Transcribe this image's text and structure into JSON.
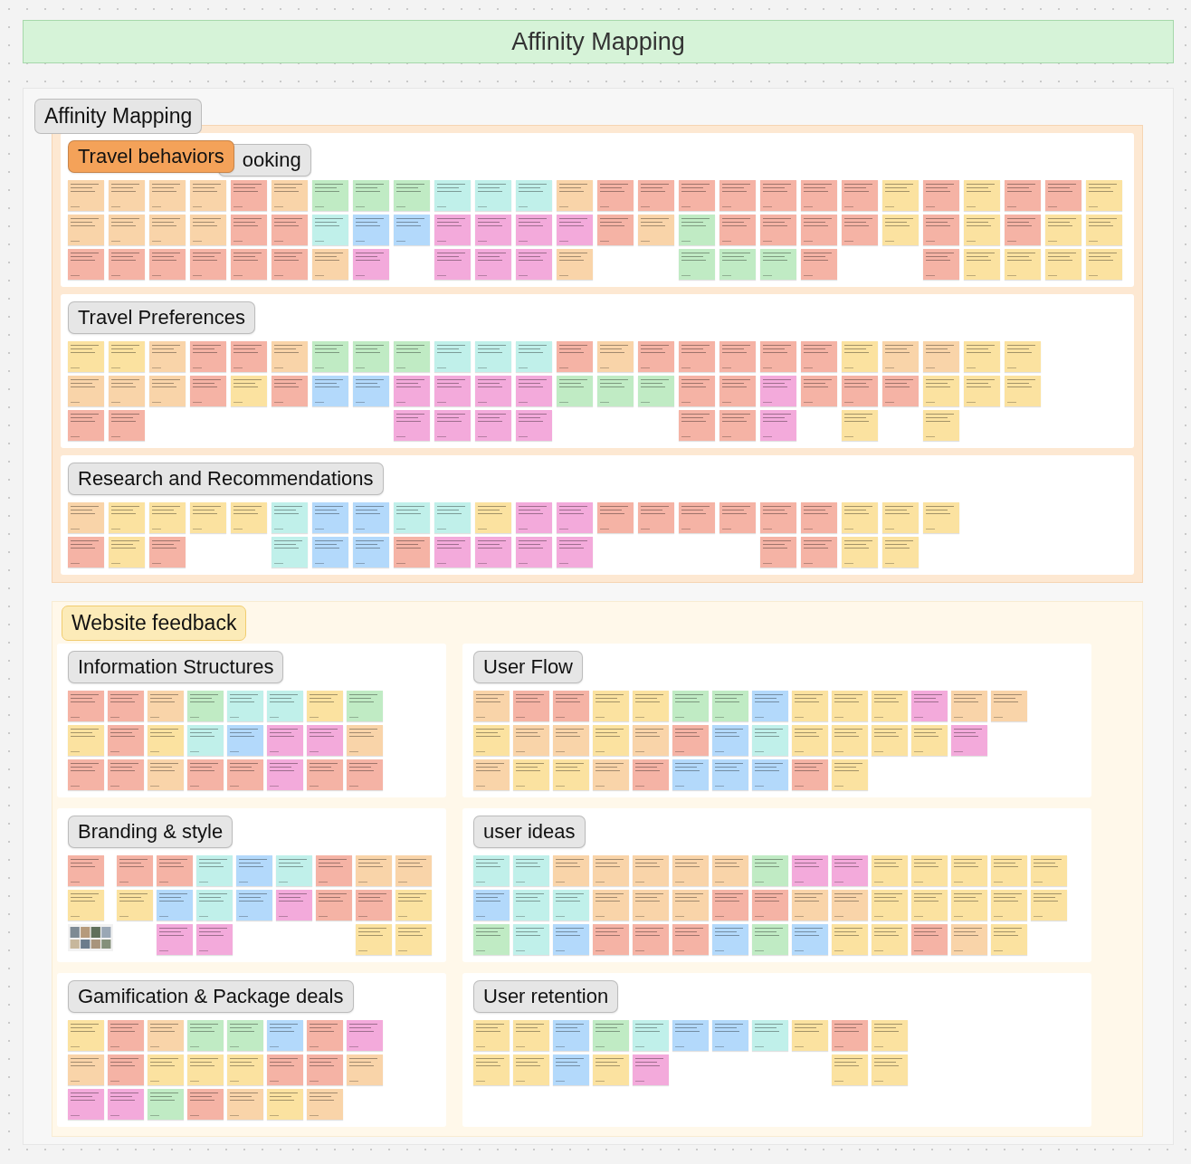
{
  "banner": {
    "title": "Affinity Mapping"
  },
  "sections": [
    {
      "kind": "stack",
      "label": {
        "text": "Affinity Mapping",
        "color": "#e6e6e6"
      },
      "color": "#fde8d2",
      "panels": [
        {
          "labels": [
            {
              "text": "Travel behaviors",
              "color": "#f4a259"
            },
            {
              "text": "ooking",
              "color": "#e6e6e6"
            }
          ],
          "columns": [
            [
              {
                "color": "#f9d4a9"
              },
              {
                "color": "#f9d4a9"
              },
              {
                "color": "#f5b3a5"
              }
            ],
            [
              {
                "color": "#f9d4a9"
              },
              {
                "color": "#f9d4a9"
              },
              {
                "color": "#f5b3a5"
              }
            ],
            [
              {
                "color": "#f9d4a9"
              },
              {
                "color": "#f9d4a9"
              },
              {
                "color": "#f5b3a5"
              }
            ],
            [
              {
                "color": "#f9d4a9"
              },
              {
                "color": "#f9d4a9"
              },
              {
                "color": "#f5b3a5"
              }
            ],
            [
              {
                "color": "#f5b3a5"
              },
              {
                "color": "#f5b3a5"
              },
              {
                "color": "#f5b3a5"
              }
            ],
            [
              {
                "color": "#f9d4a9"
              },
              {
                "color": "#f5b3a5"
              },
              {
                "color": "#f5b3a5"
              }
            ],
            [
              {
                "color": "#c0ebc4"
              },
              {
                "color": "#c0f0ea"
              },
              {
                "color": "#f9d4a9"
              }
            ],
            [
              {
                "color": "#c0ebc4"
              },
              {
                "color": "#b3d9fb"
              },
              {
                "color": "#f3aadb"
              }
            ],
            [
              {
                "color": "#c0ebc4"
              },
              {
                "color": "#b3d9fb"
              }
            ],
            [
              {
                "color": "#c0f0ea"
              },
              {
                "color": "#f3aadb"
              },
              {
                "color": "#f3aadb"
              }
            ],
            [
              {
                "color": "#c0f0ea"
              },
              {
                "color": "#f3aadb"
              },
              {
                "color": "#f3aadb"
              }
            ],
            [
              {
                "color": "#c0f0ea"
              },
              {
                "color": "#f3aadb"
              },
              {
                "color": "#f3aadb"
              }
            ],
            [
              {
                "color": "#f9d4a9"
              },
              {
                "color": "#f3aadb"
              },
              {
                "color": "#f9d4a9"
              }
            ],
            [
              {
                "color": "#f5b3a5"
              },
              {
                "color": "#f5b3a5"
              }
            ],
            [
              {
                "color": "#f5b3a5"
              },
              {
                "color": "#f9d4a9"
              }
            ],
            [
              {
                "color": "#f5b3a5"
              },
              {
                "color": "#c0ebc4"
              },
              {
                "color": "#c0ebc4"
              }
            ],
            [
              {
                "color": "#f5b3a5"
              },
              {
                "color": "#f5b3a5"
              },
              {
                "color": "#c0ebc4"
              }
            ],
            [
              {
                "color": "#f5b3a5"
              },
              {
                "color": "#f5b3a5"
              },
              {
                "color": "#c0ebc4"
              }
            ],
            [
              {
                "color": "#f5b3a5"
              },
              {
                "color": "#f5b3a5"
              },
              {
                "color": "#f5b3a5"
              }
            ],
            [
              {
                "color": "#f5b3a5"
              },
              {
                "color": "#f5b3a5"
              }
            ],
            [
              {
                "color": "#fbe2a0"
              },
              {
                "color": "#fbe2a0"
              }
            ],
            [
              {
                "color": "#f5b3a5"
              },
              {
                "color": "#f5b3a5"
              },
              {
                "color": "#f5b3a5"
              }
            ],
            [
              {
                "color": "#fbe2a0"
              },
              {
                "color": "#fbe2a0"
              },
              {
                "color": "#fbe2a0"
              }
            ],
            [
              {
                "color": "#f5b3a5"
              },
              {
                "color": "#f5b3a5"
              },
              {
                "color": "#fbe2a0"
              }
            ],
            [
              {
                "color": "#f5b3a5"
              },
              {
                "color": "#fbe2a0"
              },
              {
                "color": "#fbe2a0"
              }
            ],
            [
              {
                "color": "#fbe2a0"
              },
              {
                "color": "#fbe2a0"
              },
              {
                "color": "#fbe2a0"
              }
            ]
          ]
        },
        {
          "labels": [
            {
              "text": "Travel Preferences",
              "color": "#e6e6e6"
            }
          ],
          "columns": [
            [
              {
                "color": "#fbe2a0"
              },
              {
                "color": "#f9d4a9"
              },
              {
                "color": "#f5b3a5"
              }
            ],
            [
              {
                "color": "#fbe2a0"
              },
              {
                "color": "#f9d4a9"
              },
              {
                "color": "#f5b3a5"
              }
            ],
            [
              {
                "color": "#f9d4a9"
              },
              {
                "color": "#f9d4a9"
              }
            ],
            [
              {
                "color": "#f5b3a5"
              },
              {
                "color": "#f5b3a5"
              }
            ],
            [
              {
                "color": "#f5b3a5"
              },
              {
                "color": "#fbe2a0"
              }
            ],
            [
              {
                "color": "#f9d4a9"
              },
              {
                "color": "#f5b3a5"
              }
            ],
            [
              {
                "color": "#c0ebc4"
              },
              {
                "color": "#b3d9fb"
              }
            ],
            [
              {
                "color": "#c0ebc4"
              },
              {
                "color": "#b3d9fb"
              }
            ],
            [
              {
                "color": "#c0ebc4"
              },
              {
                "color": "#f3aadb"
              },
              {
                "color": "#f3aadb"
              }
            ],
            [
              {
                "color": "#c0f0ea"
              },
              {
                "color": "#f3aadb"
              },
              {
                "color": "#f3aadb"
              }
            ],
            [
              {
                "color": "#c0f0ea"
              },
              {
                "color": "#f3aadb"
              },
              {
                "color": "#f3aadb"
              }
            ],
            [
              {
                "color": "#c0f0ea"
              },
              {
                "color": "#f3aadb"
              },
              {
                "color": "#f3aadb"
              }
            ],
            [
              {
                "color": "#f5b3a5"
              },
              {
                "color": "#c0ebc4"
              }
            ],
            [
              {
                "color": "#f9d4a9"
              },
              {
                "color": "#c0ebc4"
              }
            ],
            [
              {
                "color": "#f5b3a5"
              },
              {
                "color": "#c0ebc4"
              }
            ],
            [
              {
                "color": "#f5b3a5"
              },
              {
                "color": "#f5b3a5"
              },
              {
                "color": "#f5b3a5"
              }
            ],
            [
              {
                "color": "#f5b3a5"
              },
              {
                "color": "#f5b3a5"
              },
              {
                "color": "#f5b3a5"
              }
            ],
            [
              {
                "color": "#f5b3a5"
              },
              {
                "color": "#f3aadb"
              },
              {
                "color": "#f3aadb"
              }
            ],
            [
              {
                "color": "#f5b3a5"
              },
              {
                "color": "#f5b3a5"
              }
            ],
            [
              {
                "color": "#fbe2a0"
              },
              {
                "color": "#f5b3a5"
              },
              {
                "color": "#fbe2a0"
              }
            ],
            [
              {
                "color": "#f9d4a9"
              },
              {
                "color": "#f5b3a5"
              }
            ],
            [
              {
                "color": "#f9d4a9"
              },
              {
                "color": "#fbe2a0"
              },
              {
                "color": "#fbe2a0"
              }
            ],
            [
              {
                "color": "#fbe2a0"
              },
              {
                "color": "#fbe2a0"
              }
            ],
            [
              {
                "color": "#fbe2a0"
              },
              {
                "color": "#fbe2a0"
              }
            ]
          ]
        },
        {
          "labels": [
            {
              "text": "Research and Recommendations",
              "color": "#e6e6e6"
            }
          ],
          "columns": [
            [
              {
                "color": "#f9d4a9"
              },
              {
                "color": "#f5b3a5"
              }
            ],
            [
              {
                "color": "#fbe2a0"
              },
              {
                "color": "#fbe2a0"
              }
            ],
            [
              {
                "color": "#fbe2a0"
              },
              {
                "color": "#f5b3a5"
              }
            ],
            [
              {
                "color": "#fbe2a0"
              }
            ],
            [
              {
                "color": "#fbe2a0"
              }
            ],
            [
              {
                "color": "#c0f0ea"
              },
              {
                "color": "#c0f0ea"
              }
            ],
            [
              {
                "color": "#b3d9fb"
              },
              {
                "color": "#b3d9fb"
              }
            ],
            [
              {
                "color": "#b3d9fb"
              },
              {
                "color": "#b3d9fb"
              }
            ],
            [
              {
                "color": "#c0f0ea"
              },
              {
                "color": "#f5b3a5"
              }
            ],
            [
              {
                "color": "#c0f0ea"
              },
              {
                "color": "#f3aadb"
              }
            ],
            [
              {
                "color": "#fbe2a0"
              },
              {
                "color": "#f3aadb"
              }
            ],
            [
              {
                "color": "#f3aadb"
              },
              {
                "color": "#f3aadb"
              }
            ],
            [
              {
                "color": "#f3aadb"
              },
              {
                "color": "#f3aadb"
              }
            ],
            [
              {
                "color": "#f5b3a5"
              }
            ],
            [
              {
                "color": "#f5b3a5"
              }
            ],
            [
              {
                "color": "#f5b3a5"
              }
            ],
            [
              {
                "color": "#f5b3a5"
              }
            ],
            [
              {
                "color": "#f5b3a5"
              },
              {
                "color": "#f5b3a5"
              }
            ],
            [
              {
                "color": "#f5b3a5"
              },
              {
                "color": "#f5b3a5"
              }
            ],
            [
              {
                "color": "#fbe2a0"
              },
              {
                "color": "#fbe2a0"
              }
            ],
            [
              {
                "color": "#fbe2a0"
              },
              {
                "color": "#fbe2a0"
              }
            ],
            [
              {
                "color": "#fbe2a0"
              }
            ]
          ]
        }
      ]
    },
    {
      "kind": "grid",
      "label": {
        "text": "Website feedback",
        "color": "#fcebb8"
      },
      "color": "#fff8ea",
      "panels": [
        {
          "labels": [
            {
              "text": "Information Structures",
              "color": "#e6e6e6"
            }
          ],
          "columns": [
            [
              {
                "color": "#f5b3a5"
              },
              {
                "color": "#fbe2a0"
              },
              {
                "color": "#f5b3a5"
              }
            ],
            [
              {
                "color": "#f5b3a5"
              },
              {
                "color": "#f5b3a5"
              },
              {
                "color": "#f5b3a5"
              }
            ],
            [
              {
                "color": "#f9d4a9"
              },
              {
                "color": "#fbe2a0"
              },
              {
                "color": "#f9d4a9"
              }
            ],
            [
              {
                "color": "#c0ebc4"
              },
              {
                "color": "#c0f0ea"
              },
              {
                "color": "#f5b3a5"
              }
            ],
            [
              {
                "color": "#c0f0ea"
              },
              {
                "color": "#b3d9fb"
              },
              {
                "color": "#f5b3a5"
              }
            ],
            [
              {
                "color": "#c0f0ea"
              },
              {
                "color": "#f3aadb"
              },
              {
                "color": "#f3aadb"
              }
            ],
            [
              {
                "color": "#fbe2a0"
              },
              {
                "color": "#f3aadb"
              },
              {
                "color": "#f5b3a5"
              }
            ],
            [
              {
                "color": "#c0ebc4"
              },
              {
                "color": "#f9d4a9"
              },
              {
                "color": "#f5b3a5"
              }
            ]
          ]
        },
        {
          "labels": [
            {
              "text": "User Flow",
              "color": "#e6e6e6"
            }
          ],
          "columns": [
            [
              {
                "color": "#f9d4a9"
              },
              {
                "color": "#fbe2a0"
              },
              {
                "color": "#f9d4a9"
              }
            ],
            [
              {
                "color": "#f5b3a5"
              },
              {
                "color": "#f9d4a9"
              },
              {
                "color": "#fbe2a0"
              }
            ],
            [
              {
                "color": "#f5b3a5"
              },
              {
                "color": "#f9d4a9"
              },
              {
                "color": "#fbe2a0"
              }
            ],
            [
              {
                "color": "#fbe2a0"
              },
              {
                "color": "#fbe2a0"
              },
              {
                "color": "#f9d4a9"
              }
            ],
            [
              {
                "color": "#fbe2a0"
              },
              {
                "color": "#f9d4a9"
              },
              {
                "color": "#f5b3a5"
              }
            ],
            [
              {
                "color": "#c0ebc4"
              },
              {
                "color": "#f5b3a5"
              },
              {
                "color": "#b3d9fb"
              }
            ],
            [
              {
                "color": "#c0ebc4"
              },
              {
                "color": "#b3d9fb"
              },
              {
                "color": "#b3d9fb"
              }
            ],
            [
              {
                "color": "#b3d9fb"
              },
              {
                "color": "#c0f0ea"
              },
              {
                "color": "#b3d9fb"
              }
            ],
            [
              {
                "color": "#fbe2a0"
              },
              {
                "color": "#fbe2a0"
              },
              {
                "color": "#f5b3a5"
              }
            ],
            [
              {
                "color": "#fbe2a0"
              },
              {
                "color": "#fbe2a0"
              },
              {
                "color": "#fbe2a0"
              }
            ],
            [
              {
                "color": "#fbe2a0"
              },
              {
                "color": "#fbe2a0"
              }
            ],
            [
              {
                "color": "#f3aadb"
              },
              {
                "color": "#fbe2a0"
              }
            ],
            [
              {
                "color": "#f9d4a9"
              },
              {
                "color": "#f3aadb"
              }
            ],
            [
              {
                "color": "#f9d4a9"
              }
            ]
          ]
        },
        {
          "labels": [
            {
              "text": "Branding & style",
              "color": "#e6e6e6"
            }
          ],
          "columns": [
            [
              {
                "color": "#f5b3a5"
              },
              {
                "color": "#fbe2a0"
              },
              {
                "kind": "picture"
              }
            ],
            [
              {
                "color": "#f5b3a5"
              },
              {
                "color": "#fbe2a0"
              }
            ],
            [
              {
                "color": "#f5b3a5"
              },
              {
                "color": "#b3d9fb"
              },
              {
                "color": "#f3aadb"
              }
            ],
            [
              {
                "color": "#c0f0ea"
              },
              {
                "color": "#c0f0ea"
              },
              {
                "color": "#f3aadb"
              }
            ],
            [
              {
                "color": "#b3d9fb"
              },
              {
                "color": "#b3d9fb"
              }
            ],
            [
              {
                "color": "#c0f0ea"
              },
              {
                "color": "#f3aadb"
              }
            ],
            [
              {
                "color": "#f5b3a5"
              },
              {
                "color": "#f5b3a5"
              }
            ],
            [
              {
                "color": "#f9d4a9"
              },
              {
                "color": "#f5b3a5"
              },
              {
                "color": "#fbe2a0"
              }
            ],
            [
              {
                "color": "#f9d4a9"
              },
              {
                "color": "#fbe2a0"
              },
              {
                "color": "#fbe2a0"
              }
            ]
          ]
        },
        {
          "labels": [
            {
              "text": "user ideas",
              "color": "#e6e6e6"
            }
          ],
          "columns": [
            [
              {
                "color": "#c0f0ea"
              },
              {
                "color": "#b3d9fb"
              },
              {
                "color": "#c0ebc4"
              }
            ],
            [
              {
                "color": "#c0f0ea"
              },
              {
                "color": "#c0f0ea"
              },
              {
                "color": "#c0f0ea"
              }
            ],
            [
              {
                "color": "#f9d4a9"
              },
              {
                "color": "#c0f0ea"
              },
              {
                "color": "#b3d9fb"
              }
            ],
            [
              {
                "color": "#f9d4a9"
              },
              {
                "color": "#f9d4a9"
              },
              {
                "color": "#f5b3a5"
              }
            ],
            [
              {
                "color": "#f9d4a9"
              },
              {
                "color": "#f9d4a9"
              },
              {
                "color": "#f5b3a5"
              }
            ],
            [
              {
                "color": "#f9d4a9"
              },
              {
                "color": "#f9d4a9"
              },
              {
                "color": "#f5b3a5"
              }
            ],
            [
              {
                "color": "#f9d4a9"
              },
              {
                "color": "#f5b3a5"
              },
              {
                "color": "#b3d9fb"
              }
            ],
            [
              {
                "color": "#c0ebc4"
              },
              {
                "color": "#f5b3a5"
              },
              {
                "color": "#c0ebc4"
              }
            ],
            [
              {
                "color": "#f3aadb"
              },
              {
                "color": "#f9d4a9"
              },
              {
                "color": "#b3d9fb"
              }
            ],
            [
              {
                "color": "#f3aadb"
              },
              {
                "color": "#f9d4a9"
              },
              {
                "color": "#fbe2a0"
              }
            ],
            [
              {
                "color": "#fbe2a0"
              },
              {
                "color": "#fbe2a0"
              },
              {
                "color": "#fbe2a0"
              }
            ],
            [
              {
                "color": "#fbe2a0"
              },
              {
                "color": "#fbe2a0"
              },
              {
                "color": "#f5b3a5"
              }
            ],
            [
              {
                "color": "#fbe2a0"
              },
              {
                "color": "#fbe2a0"
              },
              {
                "color": "#f9d4a9"
              }
            ],
            [
              {
                "color": "#fbe2a0"
              },
              {
                "color": "#fbe2a0"
              },
              {
                "color": "#fbe2a0"
              }
            ],
            [
              {
                "color": "#fbe2a0"
              },
              {
                "color": "#fbe2a0"
              }
            ]
          ]
        },
        {
          "labels": [
            {
              "text": "Gamification & Package deals",
              "color": "#e6e6e6"
            }
          ],
          "columns": [
            [
              {
                "color": "#fbe2a0"
              },
              {
                "color": "#f9d4a9"
              },
              {
                "color": "#f3aadb"
              }
            ],
            [
              {
                "color": "#f5b3a5"
              },
              {
                "color": "#f5b3a5"
              },
              {
                "color": "#f3aadb"
              }
            ],
            [
              {
                "color": "#f9d4a9"
              },
              {
                "color": "#fbe2a0"
              },
              {
                "color": "#c0ebc4"
              }
            ],
            [
              {
                "color": "#c0ebc4"
              },
              {
                "color": "#fbe2a0"
              },
              {
                "color": "#f5b3a5"
              }
            ],
            [
              {
                "color": "#c0ebc4"
              },
              {
                "color": "#fbe2a0"
              },
              {
                "color": "#f9d4a9"
              }
            ],
            [
              {
                "color": "#b3d9fb"
              },
              {
                "color": "#f5b3a5"
              },
              {
                "color": "#fbe2a0"
              }
            ],
            [
              {
                "color": "#f5b3a5"
              },
              {
                "color": "#f5b3a5"
              },
              {
                "color": "#f9d4a9"
              }
            ],
            [
              {
                "color": "#f3aadb"
              },
              {
                "color": "#f9d4a9"
              }
            ]
          ]
        },
        {
          "labels": [
            {
              "text": "User retention",
              "color": "#e6e6e6"
            }
          ],
          "columns": [
            [
              {
                "color": "#fbe2a0"
              },
              {
                "color": "#fbe2a0"
              }
            ],
            [
              {
                "color": "#fbe2a0"
              },
              {
                "color": "#fbe2a0"
              }
            ],
            [
              {
                "color": "#b3d9fb"
              },
              {
                "color": "#b3d9fb"
              }
            ],
            [
              {
                "color": "#c0ebc4"
              },
              {
                "color": "#fbe2a0"
              }
            ],
            [
              {
                "color": "#c0f0ea"
              },
              {
                "color": "#f3aadb"
              }
            ],
            [
              {
                "color": "#b3d9fb"
              }
            ],
            [
              {
                "color": "#b3d9fb"
              }
            ],
            [
              {
                "color": "#c0f0ea"
              }
            ],
            [
              {
                "color": "#fbe2a0"
              }
            ],
            [
              {
                "color": "#f5b3a5"
              },
              {
                "color": "#fbe2a0"
              }
            ],
            [
              {
                "color": "#fbe2a0"
              },
              {
                "color": "#fbe2a0"
              }
            ]
          ]
        }
      ]
    }
  ]
}
